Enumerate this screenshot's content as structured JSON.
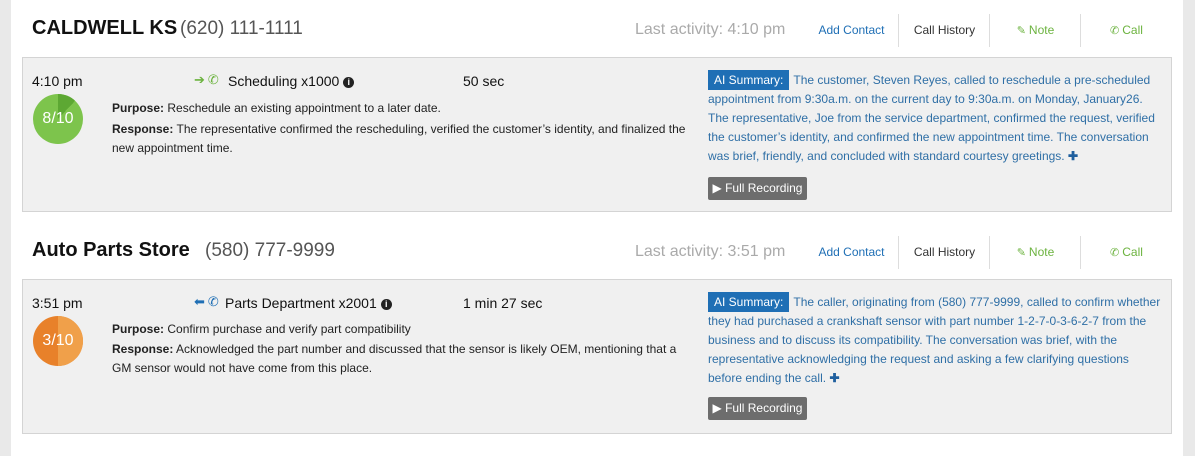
{
  "entries": [
    {
      "name": "CALDWELL KS",
      "phone": "(620) 111-1111",
      "last_activity": "Last activity: 4:10 pm",
      "actions": {
        "add_contact": "Add Contact",
        "call_history": "Call History",
        "note": "Note",
        "call": "Call"
      },
      "call": {
        "time": "4:10 pm",
        "score": "8/10",
        "score_color": "#7dc44c",
        "direction": "inbound",
        "direction_arrow": "➔",
        "phone_icon": "✆",
        "extension": "Scheduling x1000",
        "duration": "50 sec",
        "purpose_label": "Purpose:",
        "purpose": "Reschedule an existing appointment to a later date.",
        "response_label": "Response:",
        "response": "The representative confirmed the rescheduling, verified the customer’s identity, and finalized the new appointment time.",
        "ai_label": "AI Summary:",
        "ai_summary": "The customer, Steven Reyes, called to reschedule a pre-scheduled appointment from 9:30a.m. on the current day to 9:30a.m. on Monday, January26. The representative, Joe from the service department, confirmed the request, verified the customer’s identity, and confirmed the new appointment time. The conversation was brief, friendly, and concluded with standard courtesy greetings.",
        "recording": "▶ Full Recording"
      }
    },
    {
      "name": "Auto Parts Store",
      "phone": "(580) 777-9999",
      "last_activity": "Last activity: 3:51 pm",
      "actions": {
        "add_contact": "Add Contact",
        "call_history": "Call History",
        "note": "Note",
        "call": "Call"
      },
      "call": {
        "time": "3:51 pm",
        "score": "3/10",
        "score_color": "#e8812a",
        "direction": "outbound",
        "direction_arrow": "⬅",
        "phone_icon": "✆",
        "extension": "Parts Department x2001",
        "duration": "1 min 27 sec",
        "purpose_label": "Purpose:",
        "purpose": "Confirm purchase and verify part compatibility",
        "response_label": "Response:",
        "response": "Acknowledged the part number and discussed that the sensor is likely OEM, mentioning that a GM sensor would not have come from this place.",
        "ai_label": "AI Summary:",
        "ai_summary": "The caller, originating from (580) 777-9999, called to confirm whether they had purchased a crankshaft sensor with part number 1-2-7-0-3-6-2-7 from the business and to discuss its compatibility. The conversation was brief, with the representative acknowledging the request and asking a few clarifying questions before ending the call.",
        "recording": "▶ Full Recording"
      }
    }
  ]
}
